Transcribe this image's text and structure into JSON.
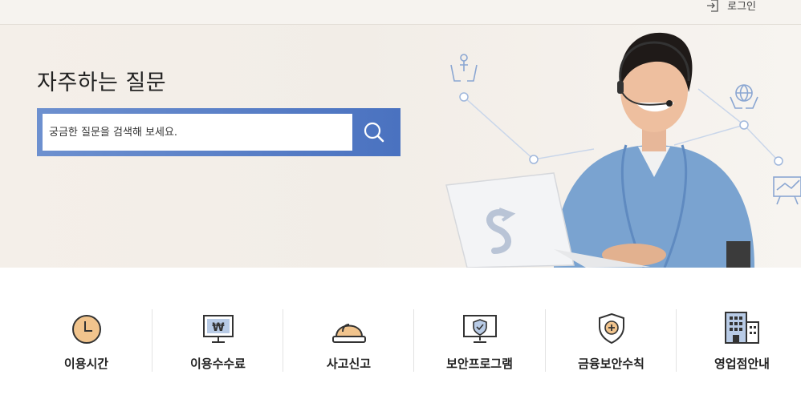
{
  "header": {
    "login_label": "로그인",
    "login_icon": "login-icon"
  },
  "hero": {
    "title": "자주하는 질문",
    "search_placeholder": "궁금한 질문을 검색해 보세요.",
    "search_icon": "search-icon",
    "accent_color": "#4f77c3"
  },
  "quick_menu": [
    {
      "label": "이용시간",
      "icon": "clock-icon"
    },
    {
      "label": "이용수수료",
      "icon": "won-monitor-icon"
    },
    {
      "label": "사고신고",
      "icon": "alarm-bell-icon"
    },
    {
      "label": "보안프로그램",
      "icon": "security-monitor-icon"
    },
    {
      "label": "금융보안수칙",
      "icon": "shield-plus-icon"
    },
    {
      "label": "영업점안내",
      "icon": "building-icon"
    }
  ]
}
